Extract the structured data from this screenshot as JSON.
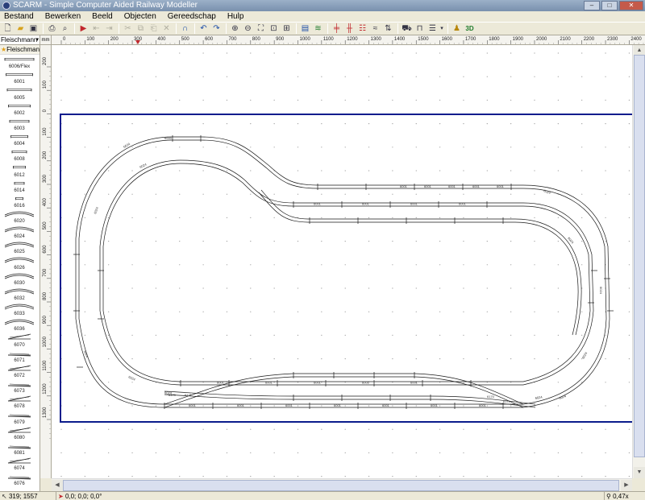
{
  "window": {
    "title": "SCARM - Simple Computer Aided Railway Modeller"
  },
  "menu": [
    "Bestand",
    "Bewerken",
    "Beeld",
    "Objecten",
    "Gereedschap",
    "Hulp"
  ],
  "library": {
    "selected": "Fleischmann",
    "header": "Fleischmann-...",
    "pieces": [
      "6006/Flex",
      "6001",
      "6005",
      "6002",
      "6003",
      "6004",
      "6008",
      "6012",
      "6014",
      "6016",
      "6020",
      "6024",
      "6025",
      "6026",
      "6030",
      "6032",
      "6033",
      "6036",
      "6070",
      "6071",
      "6072",
      "6073",
      "6078",
      "6079",
      "6080",
      "6081",
      "6074",
      "6076"
    ]
  },
  "ruler": {
    "unit": "mm",
    "top_ticks": [
      "0",
      "100",
      "200",
      "300",
      "400",
      "500",
      "600",
      "700",
      "800",
      "900",
      "1000",
      "1100",
      "1200",
      "1300",
      "1400",
      "1500",
      "1600",
      "1700",
      "1800",
      "1900",
      "2000",
      "2100",
      "2200",
      "2300",
      "2400"
    ],
    "left_ticks": [
      "200",
      "100",
      "0",
      "100",
      "200",
      "300",
      "400",
      "500",
      "600",
      "700",
      "800",
      "900",
      "1000",
      "1100",
      "1200",
      "1300"
    ]
  },
  "layout_labels": {
    "inner_bottom": [
      "6001",
      "6001",
      "6001",
      "6001",
      "6001",
      "6001",
      "6001"
    ],
    "middle_bottom": [
      "6001",
      "6001",
      "6001",
      "6001",
      "6001"
    ],
    "top_straights": [
      "6001",
      "6001",
      "6001",
      "6001",
      "6001"
    ],
    "upper_straights": [
      "6001",
      "6001",
      "6001",
      "6001"
    ],
    "curves": [
      "6024",
      "6024",
      "6024",
      "6024",
      "6024",
      "6024",
      "6024",
      "6024",
      "6024",
      "6024",
      "6024",
      "6024"
    ],
    "turnouts": [
      "6170",
      "6171",
      "6170",
      "6171"
    ],
    "top_curve": "6000"
  },
  "status": {
    "coords": "319; 1557",
    "position": "0,0; 0,0; 0,0°",
    "zoom": "0,47x"
  },
  "colors": {
    "baseboard": "#0b1c8c",
    "track": "#1a1a1a",
    "grid_dot": "#9a9a9a"
  }
}
